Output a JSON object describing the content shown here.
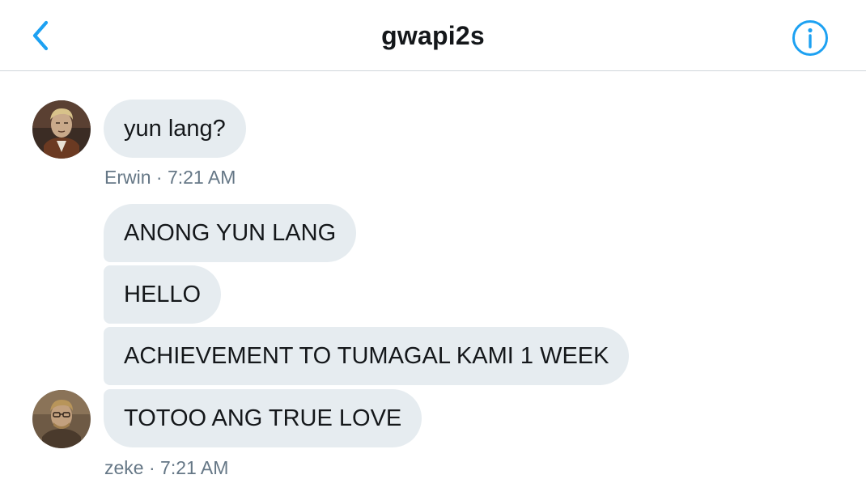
{
  "header": {
    "title": "gwapi2s",
    "back_icon": "chevron-left-icon",
    "info_icon": "info-circle-icon",
    "accent_color": "#1da1f2"
  },
  "messages": [
    {
      "group": "erwin",
      "bubbles": [
        "yun lang?"
      ],
      "sender": "Erwin",
      "time": "7:21 AM",
      "separator": "·"
    },
    {
      "group": "zeke",
      "bubbles": [
        "ANONG YUN LANG",
        "HELLO",
        "ACHIEVEMENT TO TUMAGAL KAMI 1 WEEK",
        "TOTOO ANG TRUE LOVE"
      ],
      "sender": "zeke",
      "time": "7:21 AM",
      "separator": "·"
    }
  ],
  "colors": {
    "bubble_bg": "#e6ecf0",
    "meta_text": "#657786",
    "divider": "#cfd5da"
  }
}
